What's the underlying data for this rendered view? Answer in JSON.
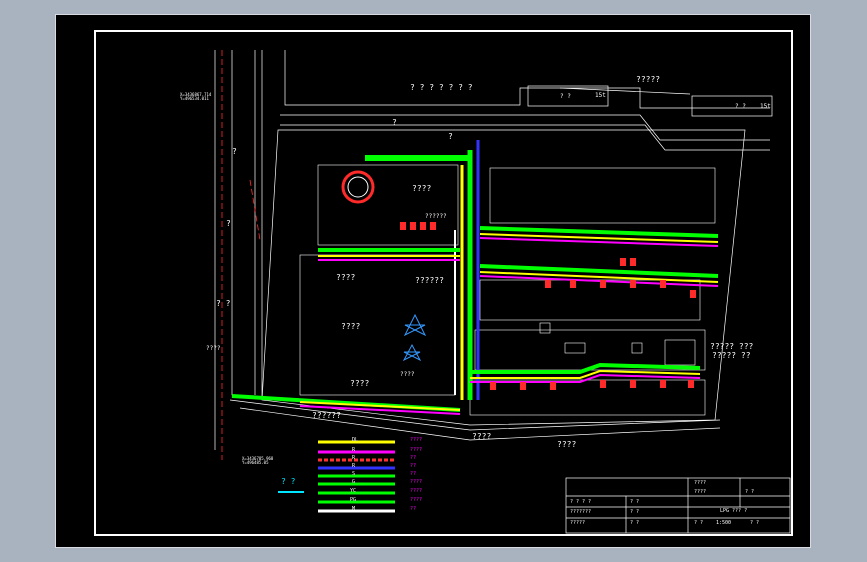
{
  "drawing": {
    "top_road_label": "? ? ? ? ? ? ?",
    "top_right_label": "?????",
    "top_right_plot_a": "? ?",
    "top_right_plot_b": "? ?",
    "plot_note_a": "15t",
    "plot_note_b": "15t",
    "coord_top": "X=3436867.714 Y=496534.011",
    "coord_bottom": "X=3436785.968 Y=496485.05",
    "coord_mid": "????",
    "left_road_q1": "?",
    "left_road_q2": "?",
    "left_road_q3": "? ?",
    "road_q_top": "?",
    "road_q_mid": "?",
    "bldg_main": "????",
    "bldg_small": "??????",
    "bldg_left": "????",
    "bldg_left2": "????",
    "bldg_mid": "??????",
    "bldg_bottom": "????",
    "bldg_bottom2": "????",
    "bldg_right_note": "????? ???",
    "bldg_right_note2": "????? ??",
    "bottom_gate_label": "????",
    "bottom_road_label": "????",
    "bottom_strip_label": "??????",
    "north_label": "? ?"
  },
  "legend": {
    "title": "? ?",
    "items": [
      {
        "code": "DL",
        "desc": "????",
        "color": "#ffff00"
      },
      {
        "code": "R",
        "desc": "????",
        "color": "#ff00ff"
      },
      {
        "code": "R",
        "desc": "??",
        "color": "#ff3333"
      },
      {
        "code": "R",
        "desc": "??",
        "color": "#3333ff"
      },
      {
        "code": "S",
        "desc": "??",
        "color": "#00ff00"
      },
      {
        "code": "G",
        "desc": "????",
        "color": "#00ff00"
      },
      {
        "code": "YC",
        "desc": "????",
        "color": "#00ff00"
      },
      {
        "code": "PG",
        "desc": "????",
        "color": "#00ff00"
      },
      {
        "code": "M",
        "desc": "??",
        "color": "#ffffff"
      }
    ]
  },
  "title_block": {
    "r1c1": "? ? ? ?",
    "r1c2": "? ?",
    "r1c3": "????",
    "r2c1": "???????",
    "r2c2": "? ?",
    "r2c3": "????",
    "r2c4": "? ?",
    "r3c1": "?????",
    "r3c2": "? ?",
    "r3c3": "LPG ??? ?",
    "r4c1": "? ?",
    "r4c2": "1:500",
    "r4c3": "? ?"
  }
}
